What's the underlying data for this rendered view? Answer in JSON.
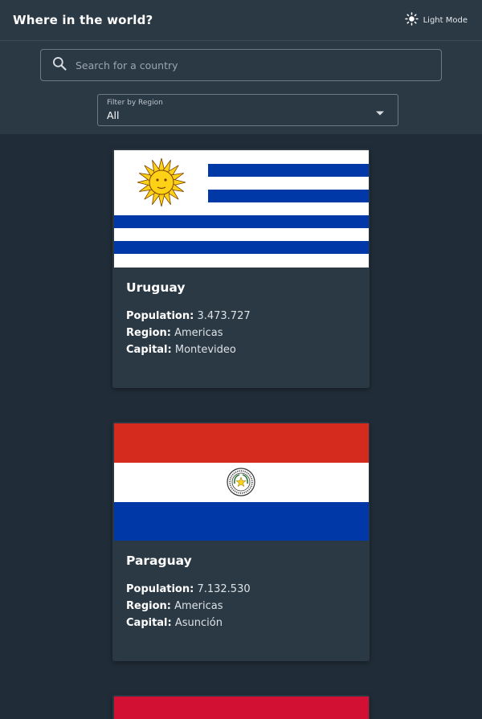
{
  "header": {
    "title": "Where in the world?",
    "theme_toggle_label": "Light Mode",
    "theme_icon": "sun-icon"
  },
  "search": {
    "placeholder": "Search for a country",
    "value": "",
    "icon": "search-icon"
  },
  "filter": {
    "label": "Filter by Region",
    "selected": "All",
    "icon": "caret-down-icon"
  },
  "field_labels": {
    "population": "Population:",
    "region": "Region:",
    "capital": "Capital:"
  },
  "countries": [
    {
      "name": "Uruguay",
      "population": "3.473.727",
      "region": "Americas",
      "capital": "Montevideo",
      "flag": "uruguay-flag"
    },
    {
      "name": "Paraguay",
      "population": "7.132.530",
      "region": "Americas",
      "capital": "Asunción",
      "flag": "paraguay-flag"
    },
    {
      "flag": "red-flag"
    }
  ],
  "colors": {
    "background": "#202c37",
    "elements": "#2b3945",
    "text": "#ffffff"
  }
}
